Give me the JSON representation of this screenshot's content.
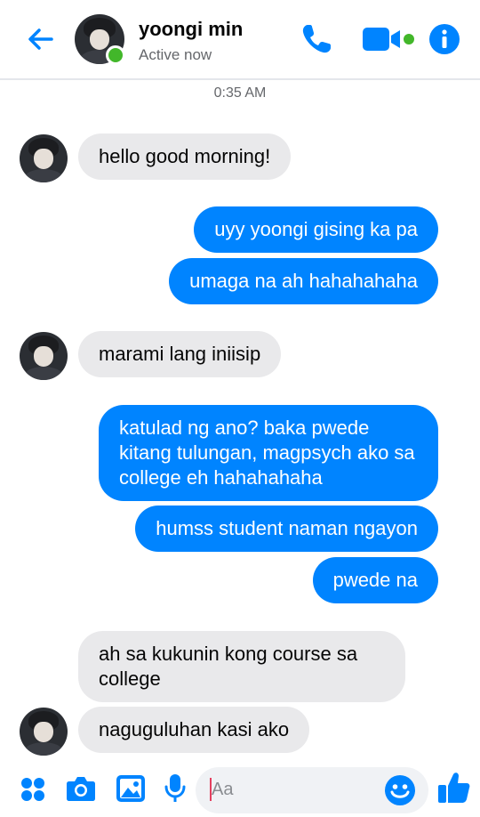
{
  "header": {
    "contact_name": "yoongi min",
    "status": "Active now",
    "icons": [
      "back-arrow-icon",
      "phone-icon",
      "video-camera-icon",
      "info-icon"
    ]
  },
  "conversation": {
    "timestamp": "0:35 AM",
    "messages": [
      {
        "from": "them",
        "text": "hello good morning!"
      },
      {
        "from": "me",
        "text": "uyy yoongi gising ka pa"
      },
      {
        "from": "me",
        "text": "umaga na ah hahahahaha"
      },
      {
        "from": "them",
        "text": "marami lang iniisip"
      },
      {
        "from": "me",
        "text": "katulad ng ano? baka pwede kitang tulungan, magpsych ako sa college eh hahahahaha"
      },
      {
        "from": "me",
        "text": "humss student naman ngayon"
      },
      {
        "from": "me",
        "text": "pwede na"
      },
      {
        "from": "them",
        "text": "ah sa kukunin kong course sa college"
      },
      {
        "from": "them",
        "text": "naguguluhan kasi ako"
      }
    ]
  },
  "composer": {
    "placeholder": "Aa",
    "icons": [
      "apps-grid-icon",
      "camera-icon",
      "gallery-icon",
      "microphone-icon",
      "emoji-icon",
      "like-thumb-icon"
    ]
  },
  "colors": {
    "accent": "#0084ff",
    "online": "#42b72a",
    "incoming_bubble": "#e9e9eb",
    "outgoing_bubble": "#0084ff"
  }
}
